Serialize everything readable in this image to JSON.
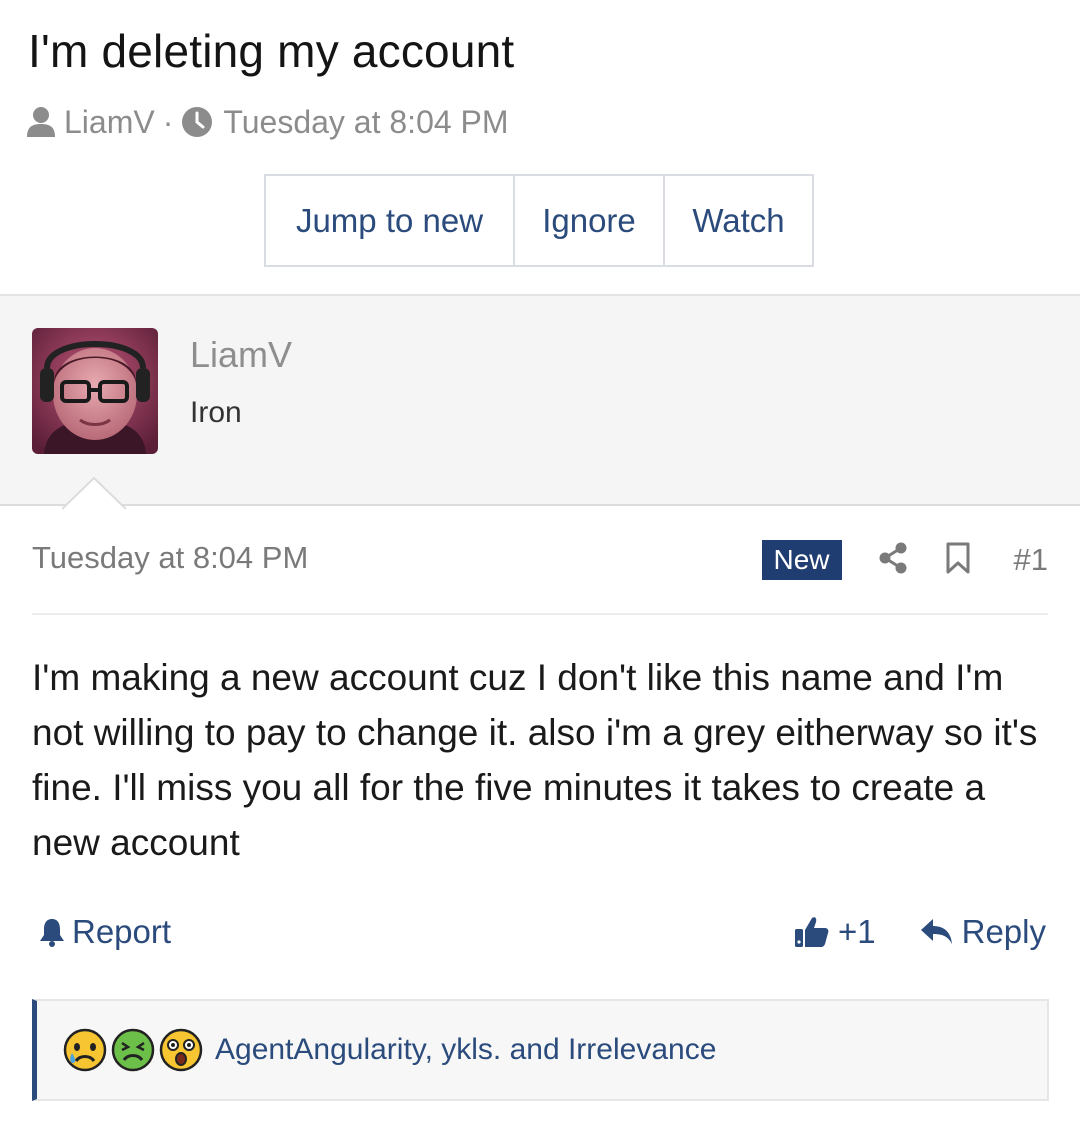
{
  "thread": {
    "title": "I'm deleting my account",
    "author": "LiamV",
    "separator": "·",
    "date": "Tuesday at 8:04 PM"
  },
  "buttons": {
    "jump": "Jump to new",
    "ignore": "Ignore",
    "watch": "Watch"
  },
  "author_panel": {
    "name": "LiamV",
    "rank": "Iron"
  },
  "post": {
    "date": "Tuesday at 8:04 PM",
    "badge": "New",
    "number": "#1",
    "body": "I'm making a new account cuz I don't like this name and I'm not willing to pay to change it. also i'm a grey eitherway so it's fine. I'll miss you all for the five minutes it takes to create a new account"
  },
  "actions": {
    "report": "Report",
    "like": "+1",
    "reply": "Reply"
  },
  "reactions": {
    "icons": [
      "sad-tear-icon",
      "sick-icon",
      "shocked-icon"
    ],
    "users": "AgentAngularity, ykls. and Irrelevance"
  },
  "colors": {
    "link": "#2a4b7c",
    "badge_bg": "#1f3d70",
    "meta_gray": "#8c8c8c"
  }
}
